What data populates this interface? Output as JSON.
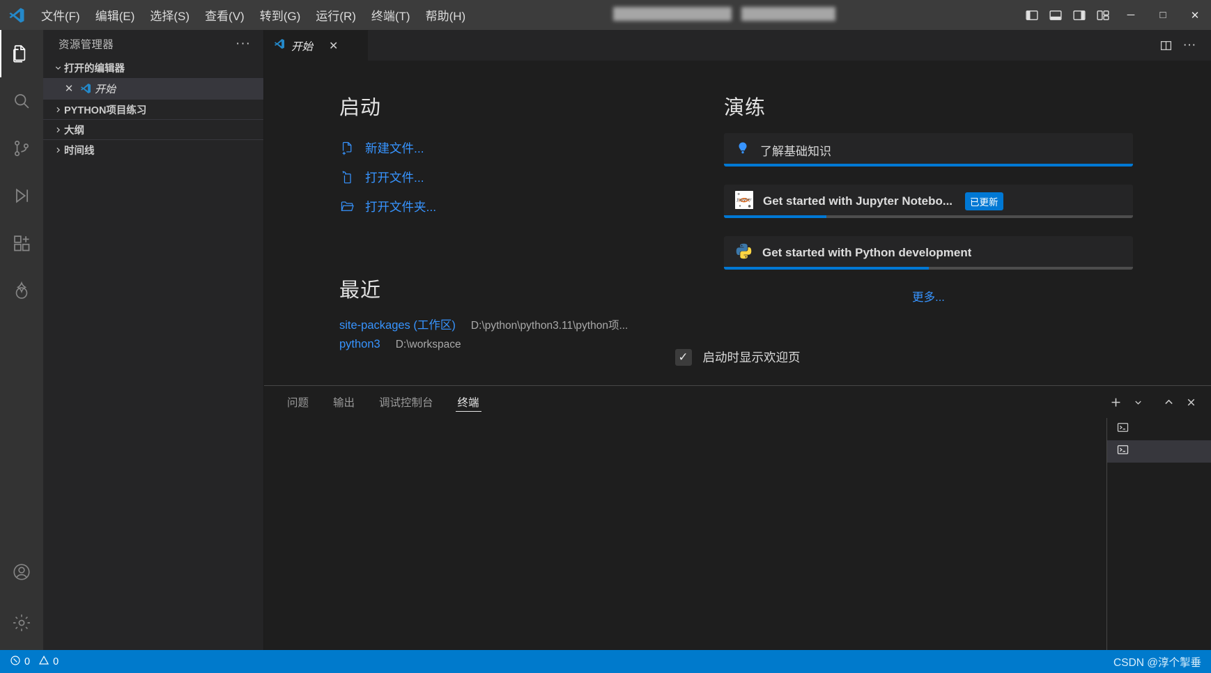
{
  "window": {
    "app_icon": "vscode-logo-icon",
    "minimize_label": "─",
    "maximize_label": "□",
    "close_label": "✕"
  },
  "menubar": {
    "items": [
      {
        "label": "文件(F)",
        "name": "menu-file"
      },
      {
        "label": "编辑(E)",
        "name": "menu-edit"
      },
      {
        "label": "选择(S)",
        "name": "menu-selection"
      },
      {
        "label": "查看(V)",
        "name": "menu-view"
      },
      {
        "label": "转到(G)",
        "name": "menu-go"
      },
      {
        "label": "运行(R)",
        "name": "menu-run"
      },
      {
        "label": "终端(T)",
        "name": "menu-terminal"
      },
      {
        "label": "帮助(H)",
        "name": "menu-help"
      }
    ]
  },
  "layout_controls": [
    {
      "name": "toggle-primary-sidebar-icon"
    },
    {
      "name": "toggle-panel-icon"
    },
    {
      "name": "toggle-secondary-sidebar-icon"
    },
    {
      "name": "customize-layout-icon"
    }
  ],
  "activitybar": {
    "items": [
      {
        "name": "activity-explorer",
        "icon": "files-icon",
        "active": true
      },
      {
        "name": "activity-search",
        "icon": "search-icon",
        "active": false
      },
      {
        "name": "activity-source-control",
        "icon": "source-control-icon",
        "active": false
      },
      {
        "name": "activity-run-debug",
        "icon": "run-debug-icon",
        "active": false
      },
      {
        "name": "activity-extensions",
        "icon": "extensions-icon",
        "active": false
      },
      {
        "name": "activity-copilot",
        "icon": "copilot-icon",
        "active": false
      }
    ],
    "bottom": [
      {
        "name": "activity-accounts",
        "icon": "account-icon"
      },
      {
        "name": "activity-settings",
        "icon": "gear-icon"
      }
    ]
  },
  "sidebar": {
    "title": "资源管理器",
    "more_actions": "···",
    "open_editors": {
      "label": "打开的编辑器",
      "expanded": true,
      "files": [
        {
          "label": "开始",
          "close": "✕",
          "icon": "vscode-logo-icon",
          "active": true
        }
      ]
    },
    "sections": [
      {
        "label": "PYTHON项目练习",
        "expanded": false,
        "name": "sidebar-section-project"
      },
      {
        "label": "大纲",
        "expanded": false,
        "name": "sidebar-section-outline"
      },
      {
        "label": "时间线",
        "expanded": false,
        "name": "sidebar-section-timeline"
      }
    ]
  },
  "tabstrip": {
    "tabs": [
      {
        "label": "开始",
        "icon": "vscode-logo-icon",
        "close": "✕",
        "active": true
      }
    ],
    "actions": [
      {
        "name": "split-editor-icon"
      },
      {
        "name": "more-actions-icon",
        "label": "···"
      }
    ]
  },
  "welcome": {
    "start": {
      "heading": "启动",
      "items": [
        {
          "label": "新建文件...",
          "icon": "new-file-icon",
          "name": "new-file-link"
        },
        {
          "label": "打开文件...",
          "icon": "open-file-icon",
          "name": "open-file-link"
        },
        {
          "label": "打开文件夹...",
          "icon": "open-folder-icon",
          "name": "open-folder-link"
        }
      ]
    },
    "recent": {
      "heading": "最近",
      "items": [
        {
          "name": "site-packages (工作区)",
          "path": "D:\\python\\python3.11\\python项..."
        },
        {
          "name": "python3",
          "path": "D:\\workspace"
        }
      ]
    },
    "walkthroughs": {
      "heading": "演练",
      "items": [
        {
          "title": "了解基础知识",
          "icon": "lightbulb-icon",
          "badge": "",
          "progress": 100,
          "bold": false,
          "name": "walkthrough-basics"
        },
        {
          "title": "Get started with Jupyter Notebo...",
          "icon": "jupyter-icon",
          "badge": "已更新",
          "progress": 25,
          "bold": true,
          "name": "walkthrough-jupyter"
        },
        {
          "title": "Get started with Python development",
          "icon": "python-icon",
          "badge": "",
          "progress": 50,
          "bold": true,
          "name": "walkthrough-python"
        }
      ],
      "more_label": "更多..."
    },
    "show_on_startup": {
      "label": "启动时显示欢迎页",
      "checked": true,
      "check_glyph": "✓"
    }
  },
  "panel": {
    "tabs": [
      {
        "label": "问题",
        "name": "panel-tab-problems",
        "active": false
      },
      {
        "label": "输出",
        "name": "panel-tab-output",
        "active": false
      },
      {
        "label": "调试控制台",
        "name": "panel-tab-debug-console",
        "active": false
      },
      {
        "label": "终端",
        "name": "panel-tab-terminal",
        "active": true
      }
    ],
    "actions": [
      {
        "name": "new-terminal-icon",
        "label": "＋"
      },
      {
        "name": "chevron-down-icon",
        "label": "⌄"
      },
      {
        "name": "maximize-panel-icon",
        "label": "⌃"
      },
      {
        "name": "close-panel-icon",
        "label": "✕"
      }
    ],
    "terminal_instances": [
      {
        "name": "terminal-instance-1",
        "icon": "terminal-icon",
        "active": false
      },
      {
        "name": "terminal-instance-2",
        "icon": "terminal-icon",
        "active": true
      }
    ]
  },
  "statusbar": {
    "errors": "0",
    "warnings": "0",
    "error_icon": "error-circle-icon",
    "warning_icon": "warning-triangle-icon",
    "watermark": "CSDN @淳个掣垂"
  },
  "colors": {
    "accent": "#007acc",
    "link": "#3794ff",
    "badge": "#0078d4",
    "titlebar": "#3c3c3c",
    "sidebar": "#252526",
    "editor": "#1e1e1e",
    "activitybar": "#333333"
  }
}
